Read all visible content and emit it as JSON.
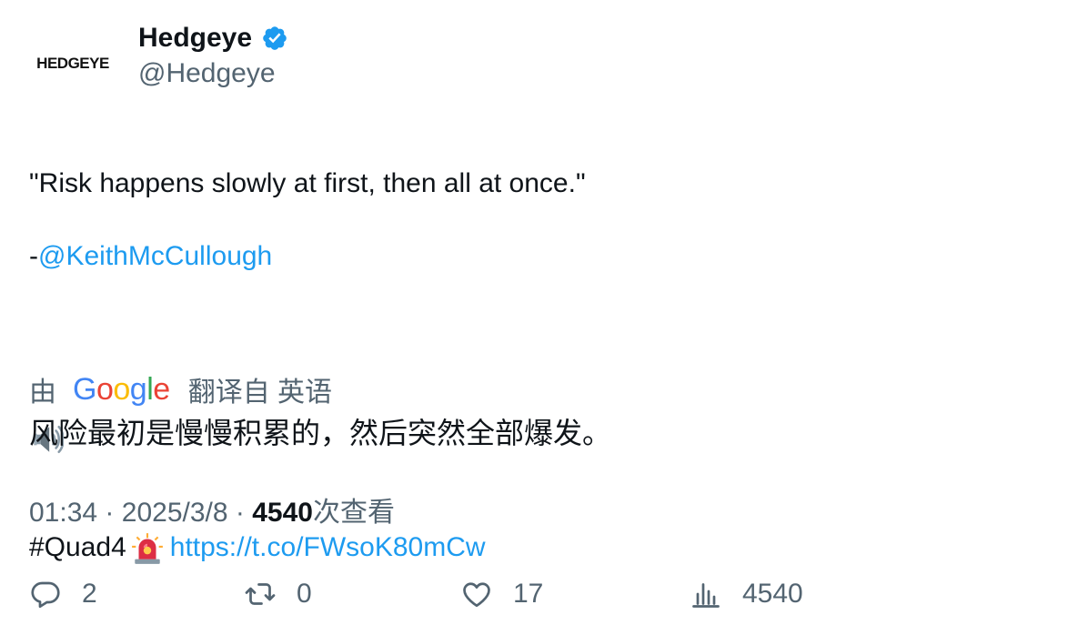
{
  "author": {
    "avatar_text": "HEDGEYE",
    "display_name": "Hedgeye",
    "handle": "@Hedgeye",
    "verified_icon": "verified-badge-icon",
    "verified_color": "#1d9bf0"
  },
  "tweet": {
    "line1": "\"Risk happens slowly at first, then all at once.\"",
    "line2_prefix": "-",
    "mention": "@KeithMcCullough",
    "speaker_emoji": "speaker-icon",
    "hashtag": "#Quad4",
    "siren_emoji": "siren-icon",
    "url": "https://t.co/FWsoK80mCw"
  },
  "translation": {
    "prefix": "由",
    "provider": "Google",
    "suffix": "翻译自 英语",
    "text": "风险最初是慢慢积累的，然后突然全部爆发。"
  },
  "meta": {
    "time": "01:34",
    "separator": "·",
    "date": "2025/3/8",
    "views_count": "4540",
    "views_label": "次查看"
  },
  "actions": {
    "replies": "2",
    "retweets": "0",
    "likes": "17",
    "views": "4540"
  },
  "colors": {
    "link": "#1d9bf0",
    "secondary_text": "#536471",
    "primary_text": "#0f1419"
  }
}
